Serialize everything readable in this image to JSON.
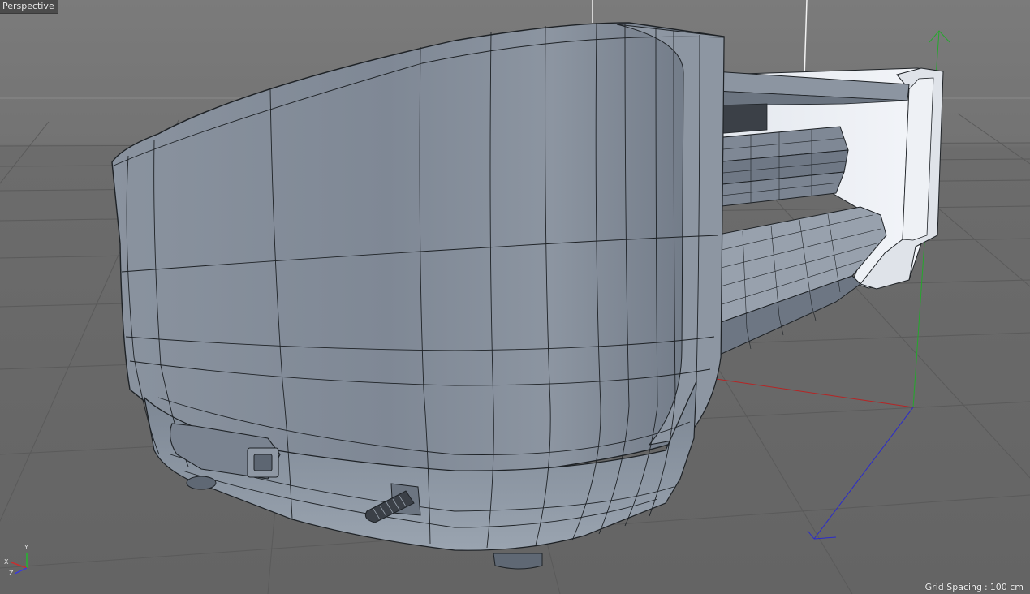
{
  "viewport": {
    "view_name": "Perspective",
    "grid_spacing_label": "Grid Spacing",
    "grid_spacing_value": "100 cm"
  },
  "axes": {
    "x_label": "X",
    "y_label": "Y",
    "z_label": "Z",
    "x_color": "#c02020",
    "y_color": "#1fa02a",
    "z_color": "#2a2ad0"
  },
  "colors": {
    "background_top": "#7a7a7a",
    "floor": "#6a6a6a",
    "model_surface": "#7c8694",
    "model_highlight": "#b9c2cc",
    "wire": "#1e2226",
    "grid_line": "#585858"
  },
  "scene": {
    "object": "poly-mesh-printer-body"
  }
}
